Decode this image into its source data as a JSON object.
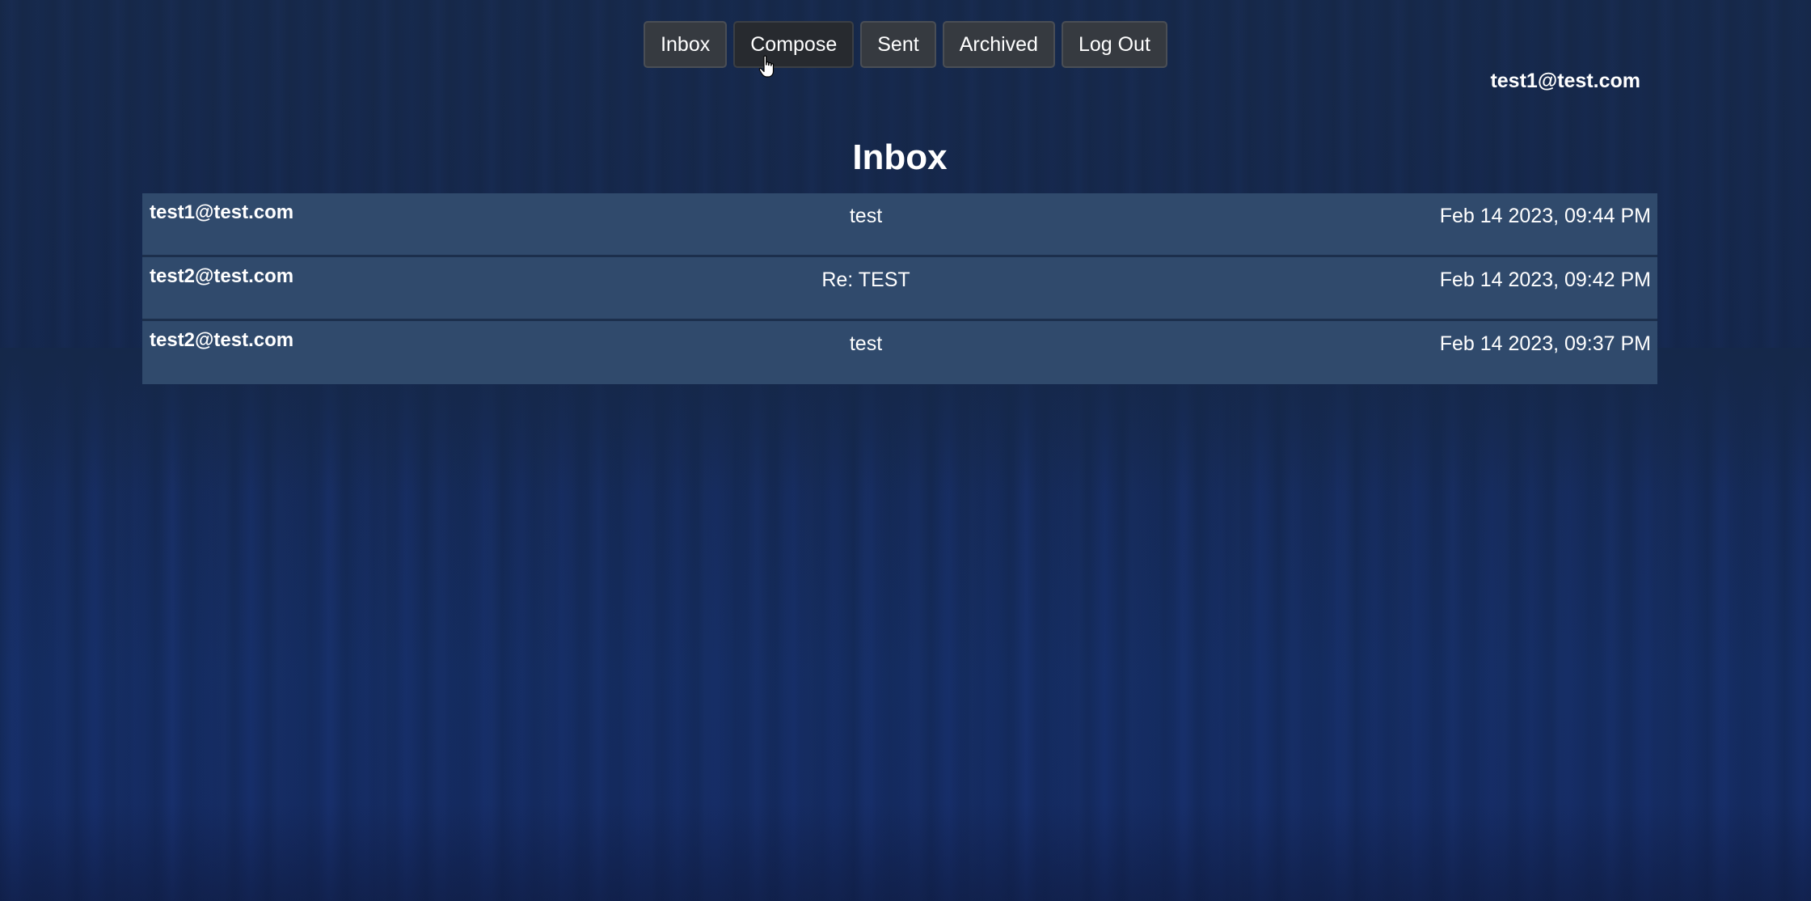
{
  "nav": {
    "items": [
      {
        "label": "Inbox"
      },
      {
        "label": "Compose"
      },
      {
        "label": "Sent"
      },
      {
        "label": "Archived"
      },
      {
        "label": "Log Out"
      }
    ]
  },
  "user": {
    "email": "test1@test.com"
  },
  "page": {
    "title": "Inbox"
  },
  "emails": [
    {
      "sender": "test1@test.com",
      "subject": "test",
      "timestamp": "Feb 14 2023, 09:44 PM"
    },
    {
      "sender": "test2@test.com",
      "subject": "Re: TEST",
      "timestamp": "Feb 14 2023, 09:42 PM"
    },
    {
      "sender": "test2@test.com",
      "subject": "test",
      "timestamp": "Feb 14 2023, 09:37 PM"
    }
  ],
  "colors": {
    "background": "#15284a",
    "row": "#304a6c",
    "button": "#363a40"
  },
  "cursor": {
    "icon": "hand-pointer-icon"
  }
}
